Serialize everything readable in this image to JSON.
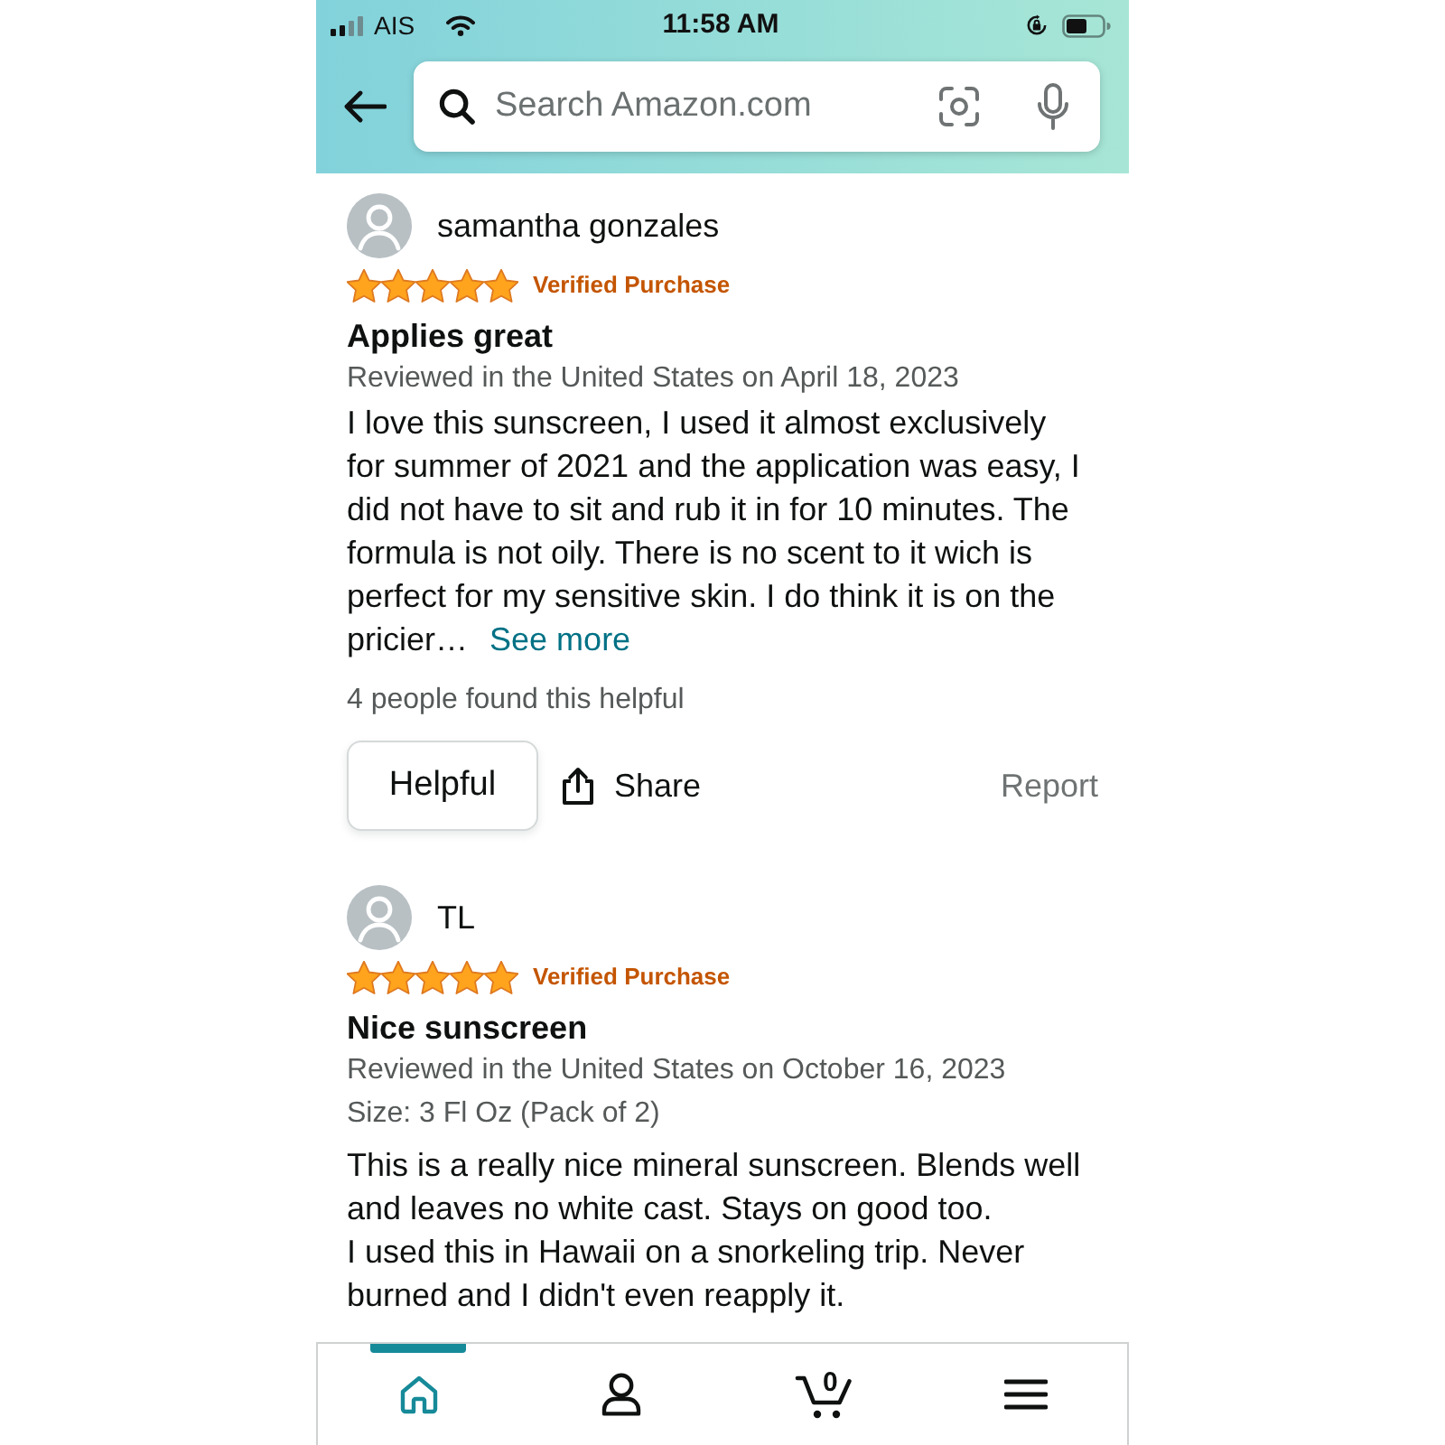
{
  "status_bar": {
    "carrier": "AIS",
    "time": "11:58 AM"
  },
  "search": {
    "placeholder": "Search Amazon.com"
  },
  "reviews": [
    {
      "author": "samantha gonzales",
      "stars": 5,
      "badge": "Verified Purchase",
      "title": "Applies great",
      "date_line": "Reviewed in the United States on April 18, 2023",
      "body": "I love this sunscreen, I used it almost exclusively for summer of 2021 and the application was easy, I did not have to sit and rub it in for 10 minutes. The formula is not oily. There is no scent to it wich is perfect for my sensitive skin. I do think it is on the pricier…",
      "more_link": "See more",
      "helpful_count": "4 people found this helpful",
      "buttons": [
        {
          "kind": "helpful",
          "label": "Helpful"
        },
        {
          "kind": "share",
          "label": "Share"
        },
        {
          "kind": "report",
          "label": "Report"
        }
      ]
    },
    {
      "author": "TL",
      "stars": 5,
      "badge": "Verified Purchase",
      "title": "Nice sunscreen",
      "date_line": "Reviewed in the United States on October 16, 2023",
      "variant": "Size: 3 Fl Oz (Pack of 2)",
      "body": "This is a really nice mineral sunscreen. Blends well and leaves no white cast. Stays on good too.\nI used this in Hawaii on a snorkeling trip. Never burned and I didn't even reapply it."
    }
  ],
  "bottom_nav": [
    {
      "kind": "home",
      "selected": true
    },
    {
      "kind": "account",
      "selected": false
    },
    {
      "kind": "cart",
      "selected": false,
      "count": "0"
    },
    {
      "kind": "menu",
      "selected": false
    }
  ]
}
